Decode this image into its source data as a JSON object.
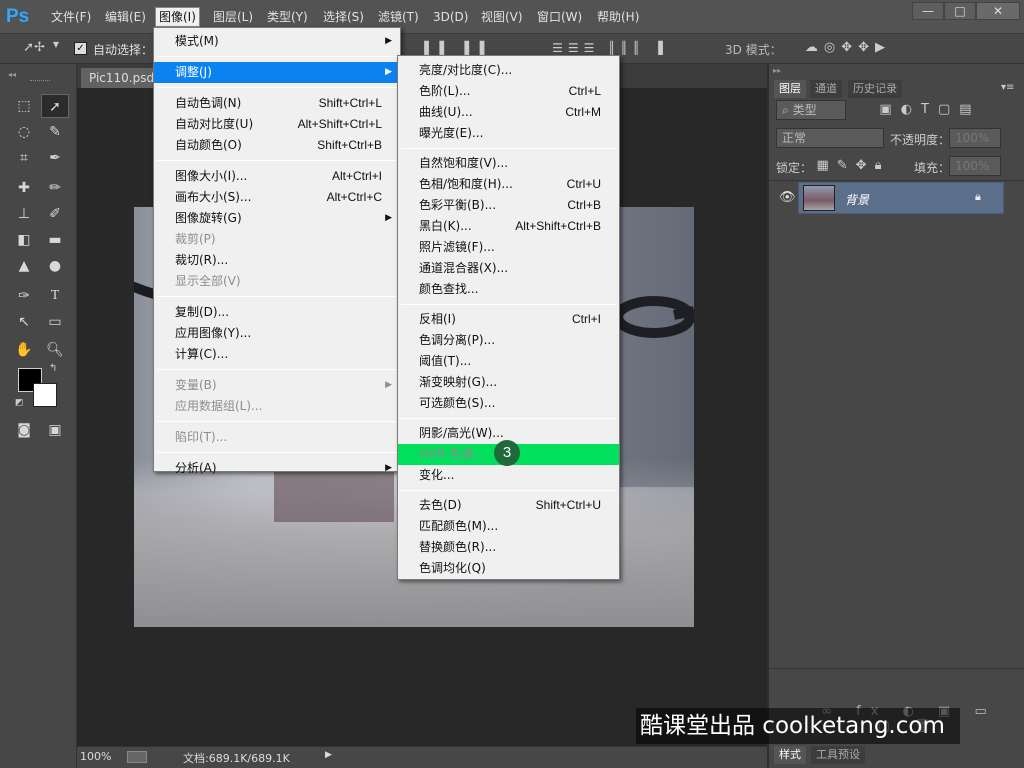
{
  "app": {
    "logo": "Ps"
  },
  "menubar": {
    "items": [
      "文件(F)",
      "编辑(E)",
      "图像(I)",
      "图层(L)",
      "类型(Y)",
      "选择(S)",
      "滤镜(T)",
      "3D(D)",
      "视图(V)",
      "窗口(W)",
      "帮助(H)"
    ],
    "active": "图像(I)"
  },
  "window_controls": {
    "minimize": "—",
    "restore": "□",
    "close": "✕"
  },
  "options_bar": {
    "auto_select_label": "自动选择：",
    "mode3d_label": "3D 模式："
  },
  "document": {
    "tab_label": "Pic110.psd @"
  },
  "status_bar": {
    "zoom": "100%",
    "doc_size": "文档:689.1K/689.1K"
  },
  "panels": {
    "tabs": [
      "图层",
      "通道",
      "历史记录"
    ],
    "active_tab": "图层",
    "filter_kind": "类型",
    "blend_mode": "正常",
    "opacity_label": "不透明度：",
    "opacity_value": "100%",
    "lock_label": "锁定：",
    "fill_label": "填充：",
    "fill_value": "100%",
    "layer_name": "背景",
    "bottom_tabs": [
      "样式",
      "工具预设"
    ]
  },
  "image_menu": {
    "items": [
      {
        "label": "模式(M)",
        "submenu": true
      },
      {
        "sep": true
      },
      {
        "label": "调整(J)",
        "submenu": true,
        "highlighted": true
      },
      {
        "sep": true
      },
      {
        "label": "自动色调(N)",
        "shortcut": "Shift+Ctrl+L"
      },
      {
        "label": "自动对比度(U)",
        "shortcut": "Alt+Shift+Ctrl+L"
      },
      {
        "label": "自动颜色(O)",
        "shortcut": "Shift+Ctrl+B"
      },
      {
        "sep": true
      },
      {
        "label": "图像大小(I)...",
        "shortcut": "Alt+Ctrl+I"
      },
      {
        "label": "画布大小(S)...",
        "shortcut": "Alt+Ctrl+C"
      },
      {
        "label": "图像旋转(G)",
        "submenu": true
      },
      {
        "label": "裁剪(P)",
        "disabled": true
      },
      {
        "label": "裁切(R)..."
      },
      {
        "label": "显示全部(V)",
        "disabled": true
      },
      {
        "sep": true
      },
      {
        "label": "复制(D)..."
      },
      {
        "label": "应用图像(Y)..."
      },
      {
        "label": "计算(C)..."
      },
      {
        "sep": true
      },
      {
        "label": "变量(B)",
        "submenu": true,
        "disabled": true
      },
      {
        "label": "应用数据组(L)...",
        "disabled": true
      },
      {
        "sep": true
      },
      {
        "label": "陷印(T)...",
        "disabled": true
      },
      {
        "sep": true
      },
      {
        "label": "分析(A)",
        "submenu": true
      }
    ]
  },
  "adjust_menu": {
    "items": [
      {
        "label": "亮度/对比度(C)..."
      },
      {
        "label": "色阶(L)...",
        "shortcut": "Ctrl+L"
      },
      {
        "label": "曲线(U)...",
        "shortcut": "Ctrl+M"
      },
      {
        "label": "曝光度(E)..."
      },
      {
        "sep": true
      },
      {
        "label": "自然饱和度(V)..."
      },
      {
        "label": "色相/饱和度(H)...",
        "shortcut": "Ctrl+U"
      },
      {
        "label": "色彩平衡(B)...",
        "shortcut": "Ctrl+B"
      },
      {
        "label": "黑白(K)...",
        "shortcut": "Alt+Shift+Ctrl+B"
      },
      {
        "label": "照片滤镜(F)..."
      },
      {
        "label": "通道混合器(X)..."
      },
      {
        "label": "颜色查找..."
      },
      {
        "sep": true
      },
      {
        "label": "反相(I)",
        "shortcut": "Ctrl+I"
      },
      {
        "label": "色调分离(P)..."
      },
      {
        "label": "阈值(T)..."
      },
      {
        "label": "渐变映射(G)..."
      },
      {
        "label": "可选颜色(S)..."
      },
      {
        "sep": true
      },
      {
        "label": "阴影/高光(W)..."
      },
      {
        "label": "HDR 色调...",
        "disabled": true,
        "target": true
      },
      {
        "label": "变化..."
      },
      {
        "sep": true
      },
      {
        "label": "去色(D)",
        "shortcut": "Shift+Ctrl+U"
      },
      {
        "label": "匹配颜色(M)..."
      },
      {
        "label": "替换颜色(R)..."
      },
      {
        "label": "色调均化(Q)"
      }
    ]
  },
  "annotation": {
    "step_number": "3"
  },
  "watermark": {
    "text": "酷课堂出品 coolketang.com"
  },
  "colors": {
    "menu_highlight": "#0a83f0",
    "target_highlight": "#00e05c",
    "ps_blue": "#31a8ff",
    "layer_selected": "#5b6f8a"
  }
}
